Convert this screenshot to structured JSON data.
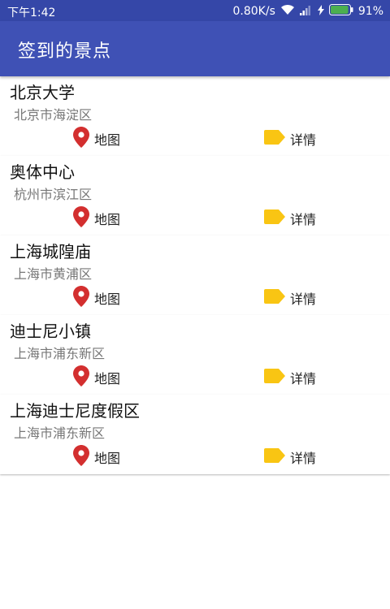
{
  "status_bar": {
    "time": "下午1:42",
    "network_speed": "0.80K/s",
    "battery": "91%"
  },
  "app_bar": {
    "title": "签到的景点"
  },
  "places": [
    {
      "name": "北京大学",
      "address": "北京市海淀区",
      "map_label": "地图",
      "detail_label": "详情"
    },
    {
      "name": "奥体中心",
      "address": "杭州市滨江区",
      "map_label": "地图",
      "detail_label": "详情"
    },
    {
      "name": "上海城隍庙",
      "address": "上海市黄浦区",
      "map_label": "地图",
      "detail_label": "详情"
    },
    {
      "name": "迪士尼小镇",
      "address": "上海市浦东新区",
      "map_label": "地图",
      "detail_label": "详情"
    },
    {
      "name": "上海迪士尼度假区",
      "address": "上海市浦东新区",
      "map_label": "地图",
      "detail_label": "详情"
    }
  ],
  "colors": {
    "app_bar": "#3f51b5",
    "status_bar": "#3547a8",
    "map_pin": "#d32f2f",
    "detail_tag": "#f9c513"
  },
  "icons": {
    "map": "map-pin-icon",
    "detail": "tag-icon"
  }
}
